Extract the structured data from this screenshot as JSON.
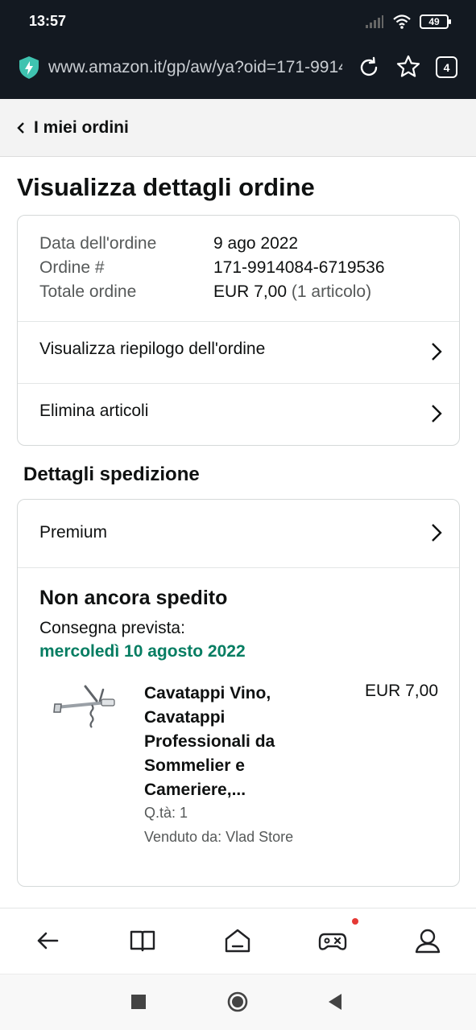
{
  "status_bar": {
    "time": "13:57",
    "battery": "49"
  },
  "browser": {
    "url": "www.amazon.it/gp/aw/ya?oid=171-9914084-6719536",
    "tab_count": "4"
  },
  "breadcrumb": {
    "label": "I miei ordini"
  },
  "page": {
    "title": "Visualizza dettagli ordine"
  },
  "order_info": {
    "rows": [
      {
        "label": "Data dell'ordine",
        "value": "9 ago 2022"
      },
      {
        "label": "Ordine #",
        "value": "171-9914084-6719536"
      },
      {
        "label": "Totale ordine",
        "value": "EUR 7,00"
      }
    ],
    "items_count": "(1 articolo)"
  },
  "order_links": {
    "summary": "Visualizza riepilogo dell'ordine",
    "delete_items": "Elimina articoli"
  },
  "shipment": {
    "section_title": "Dettagli spedizione",
    "method": "Premium",
    "status": "Non ancora spedito",
    "delivery_label": "Consegna prevista:",
    "delivery_date": "mercoledì 10 agosto 2022"
  },
  "product": {
    "title_lines": [
      "Cavatappi Vino,",
      "Cavatappi",
      "Professionali da",
      "Sommelier e",
      "Cameriere,..."
    ],
    "price": "EUR 7,00",
    "quantity": "Q.tà: 1",
    "seller": "Venduto da: Vlad Store"
  },
  "colors": {
    "header_bg": "#131921",
    "delivery_green": "#067d62",
    "notification_dot": "#e53935"
  },
  "icons": {
    "bottom_nav": [
      "back-arrow-icon",
      "book-icon",
      "home-icon",
      "gamepad-icon",
      "profile-icon"
    ],
    "system_nav": [
      "recents-square-icon",
      "home-circle-icon",
      "back-triangle-icon"
    ]
  }
}
